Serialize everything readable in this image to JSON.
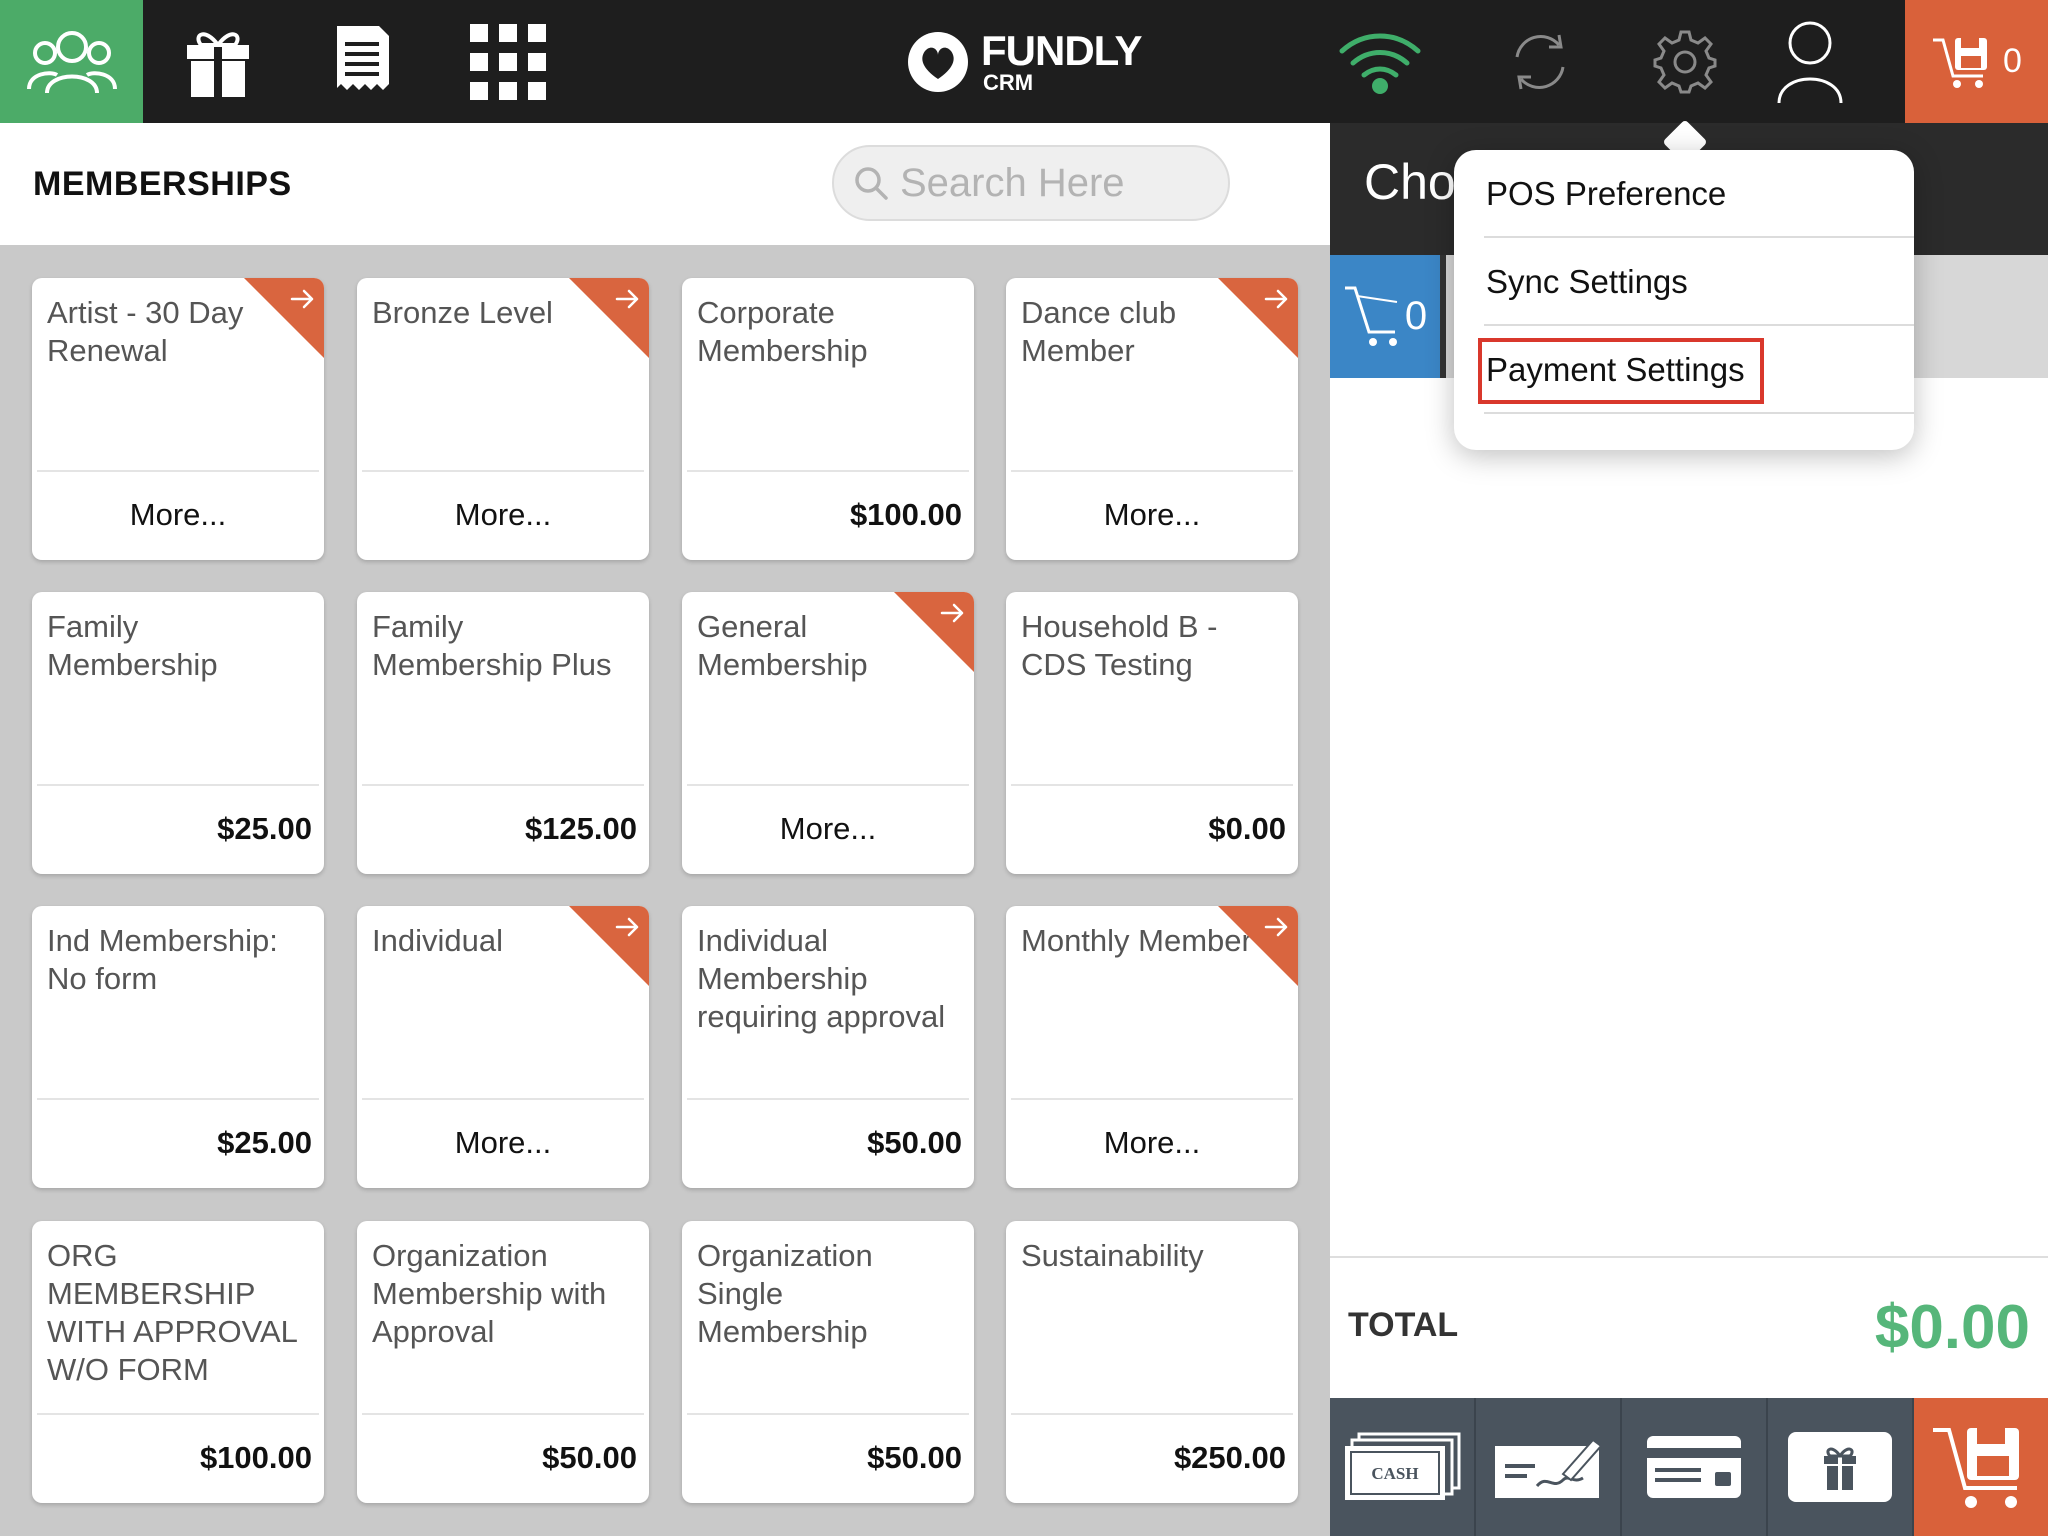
{
  "brand": {
    "name": "FUNDLY",
    "sub": "CRM"
  },
  "topbar": {
    "cart_count": "0",
    "colors": {
      "bar": "#1e1e1e",
      "active": "#4cab68",
      "cart": "#d9613a",
      "wifi": "#3fae6a"
    }
  },
  "left": {
    "section_title": "MEMBERSHIPS",
    "search_placeholder": "Search Here"
  },
  "cards": [
    {
      "name": "Artist - 30 Day Renewal",
      "foot": "More...",
      "badge": true
    },
    {
      "name": "Bronze Level",
      "foot": "More...",
      "badge": true
    },
    {
      "name": "Corporate Membership",
      "foot": "$100.00",
      "badge": false
    },
    {
      "name": "Dance club Member",
      "foot": "More...",
      "badge": true
    },
    {
      "name": "Family Membership",
      "foot": "$25.00",
      "badge": false
    },
    {
      "name": "Family Membership Plus",
      "foot": "$125.00",
      "badge": false
    },
    {
      "name": "General Membership",
      "foot": "More...",
      "badge": true
    },
    {
      "name": "Household B - CDS Testing",
      "foot": "$0.00",
      "badge": false
    },
    {
      "name": "Ind Membership: No form",
      "foot": "$25.00",
      "badge": false
    },
    {
      "name": "Individual",
      "foot": "More...",
      "badge": true
    },
    {
      "name": "Individual Membership requiring approval",
      "foot": "$50.00",
      "badge": false
    },
    {
      "name": "Monthly Member",
      "foot": "More...",
      "badge": true
    },
    {
      "name": "ORG MEMBERSHIP WITH APPROVAL W/O FORM",
      "foot": "$100.00",
      "badge": false
    },
    {
      "name": "Organization Membership with Approval",
      "foot": "$50.00",
      "badge": false
    },
    {
      "name": "Organization Single Membership",
      "foot": "$50.00",
      "badge": false
    },
    {
      "name": "Sustainability",
      "foot": "$250.00",
      "badge": false
    }
  ],
  "right": {
    "title": "Cho",
    "cart_tab_count": "0",
    "total_label": "TOTAL",
    "total_value": "$0.00"
  },
  "payment_buttons": [
    {
      "icon": "cash-icon",
      "cash_text": "CASH"
    },
    {
      "icon": "check-icon"
    },
    {
      "icon": "credit-card-icon"
    },
    {
      "icon": "gift-card-icon"
    },
    {
      "icon": "save-cart-icon"
    }
  ],
  "settings_menu": {
    "items": [
      "POS Preference",
      "Sync Settings",
      "Payment Settings"
    ],
    "highlighted_index": 2
  }
}
